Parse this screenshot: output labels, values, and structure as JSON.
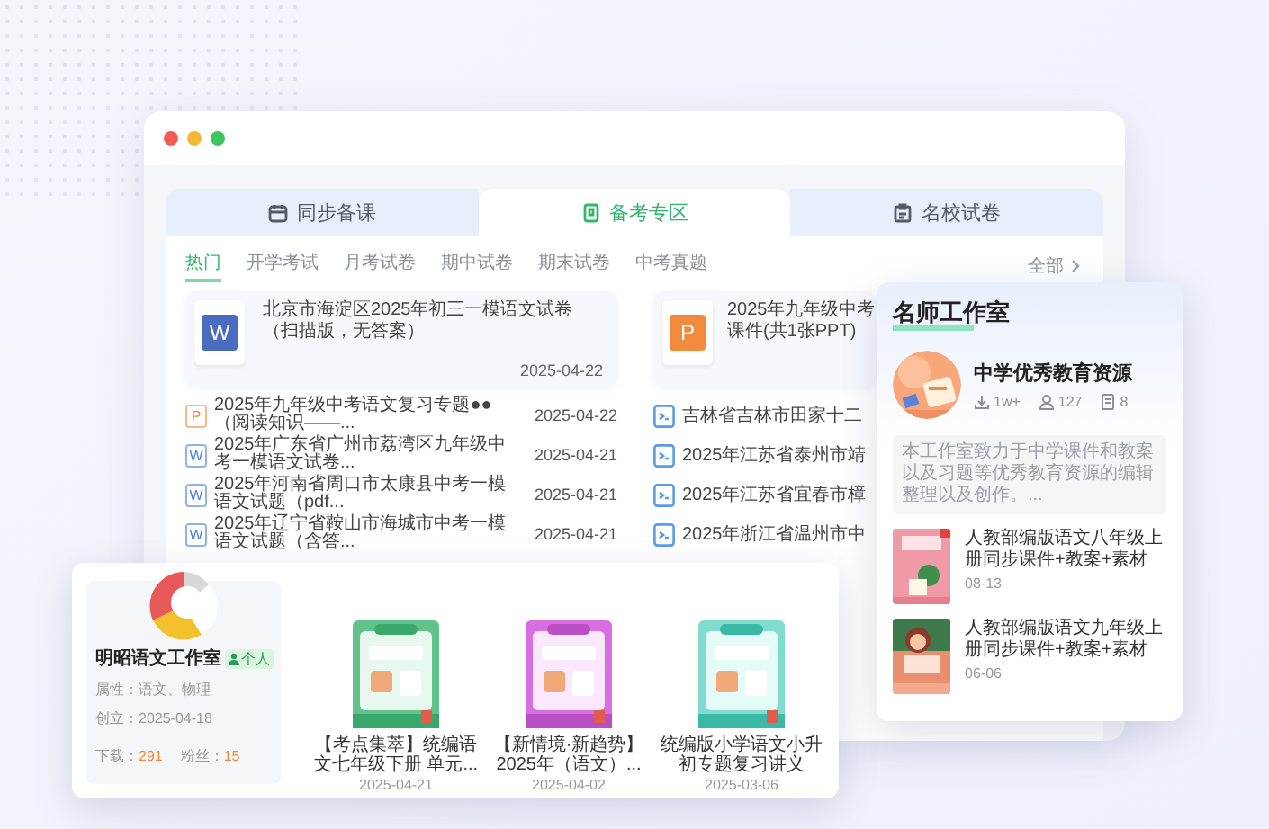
{
  "main_window": {
    "tabs": [
      {
        "label": "同步备课",
        "selected": false
      },
      {
        "label": "备考专区",
        "selected": true
      },
      {
        "label": "名校试卷",
        "selected": false
      }
    ],
    "filters": [
      {
        "label": "热门",
        "selected": true
      },
      {
        "label": "开学考试",
        "selected": false
      },
      {
        "label": "月考试卷",
        "selected": false
      },
      {
        "label": "期中试卷",
        "selected": false
      },
      {
        "label": "期末试卷",
        "selected": false
      },
      {
        "label": "中考真题",
        "selected": false
      }
    ],
    "more_link": "全部",
    "featured": [
      {
        "kind": "word",
        "letter": "W",
        "title_lines": [
          "北京市海淀区2025年初三一模语文试卷（扫描版，无答案）"
        ],
        "date": "2025-04-22"
      },
      {
        "kind": "ppt",
        "letter": "P",
        "title_lines": [
          "2025年九年级中考",
          "课件(共1张PPT)"
        ]
      }
    ],
    "left_list": [
      {
        "kind": "ppt",
        "letter": "P",
        "title": "2025年九年级中考语文复习专题●●（阅读知识——...",
        "date": "2025-04-22"
      },
      {
        "kind": "word",
        "letter": "W",
        "title": "2025年广东省广州市荔湾区九年级中考一模语文试卷...",
        "date": "2025-04-21"
      },
      {
        "kind": "word",
        "letter": "W",
        "title": "2025年河南省周口市太康县中考一模语文试题（pdf...",
        "date": "2025-04-21"
      },
      {
        "kind": "word",
        "letter": "W",
        "title": "2025年辽宁省鞍山市海城市中考一模语文试题（含答...",
        "date": "2025-04-21"
      }
    ],
    "right_list": [
      {
        "kind": "doc",
        "title": "吉林省吉林市田家十二"
      },
      {
        "kind": "doc",
        "title": "2025年江苏省泰州市靖"
      },
      {
        "kind": "doc",
        "title": "2025年江苏省宜春市樟"
      },
      {
        "kind": "doc",
        "title": "2025年浙江省温州市中"
      }
    ]
  },
  "workshop": {
    "title": "名师工作室",
    "name": "中学优秀教育资源",
    "stats": [
      {
        "value": "1w+"
      },
      {
        "value": "127"
      },
      {
        "value": "8"
      }
    ],
    "description": "本工作室致力于中学课件和教案以及习题等优秀教育资源的编辑整理以及创作。...",
    "items": [
      {
        "title": "人教部编版语文八年级上册同步课件+教案+素材",
        "date": "08-13"
      },
      {
        "title": "人教部编版语文九年级上册同步课件+教案+素材",
        "date": "06-06"
      }
    ]
  },
  "studio": {
    "name": "明昭语文工作室",
    "badge": "个人",
    "fields": [
      {
        "label": "属性：",
        "value": "语文、物理"
      },
      {
        "label": "创立：",
        "value": "2025-04-18"
      }
    ],
    "stats": [
      {
        "label": "下载：",
        "value": "291"
      },
      {
        "label": "粉丝：",
        "value": "15"
      }
    ],
    "books": [
      {
        "title": "【考点集萃】统编语文七年级下册 单元...",
        "date": "2025-04-21"
      },
      {
        "title": "【新情境·新趋势】2025年（语文）...",
        "date": "2025-04-02"
      },
      {
        "title": "统编版小学语文小升初专题复习讲义",
        "date": "2025-03-06"
      }
    ]
  }
}
